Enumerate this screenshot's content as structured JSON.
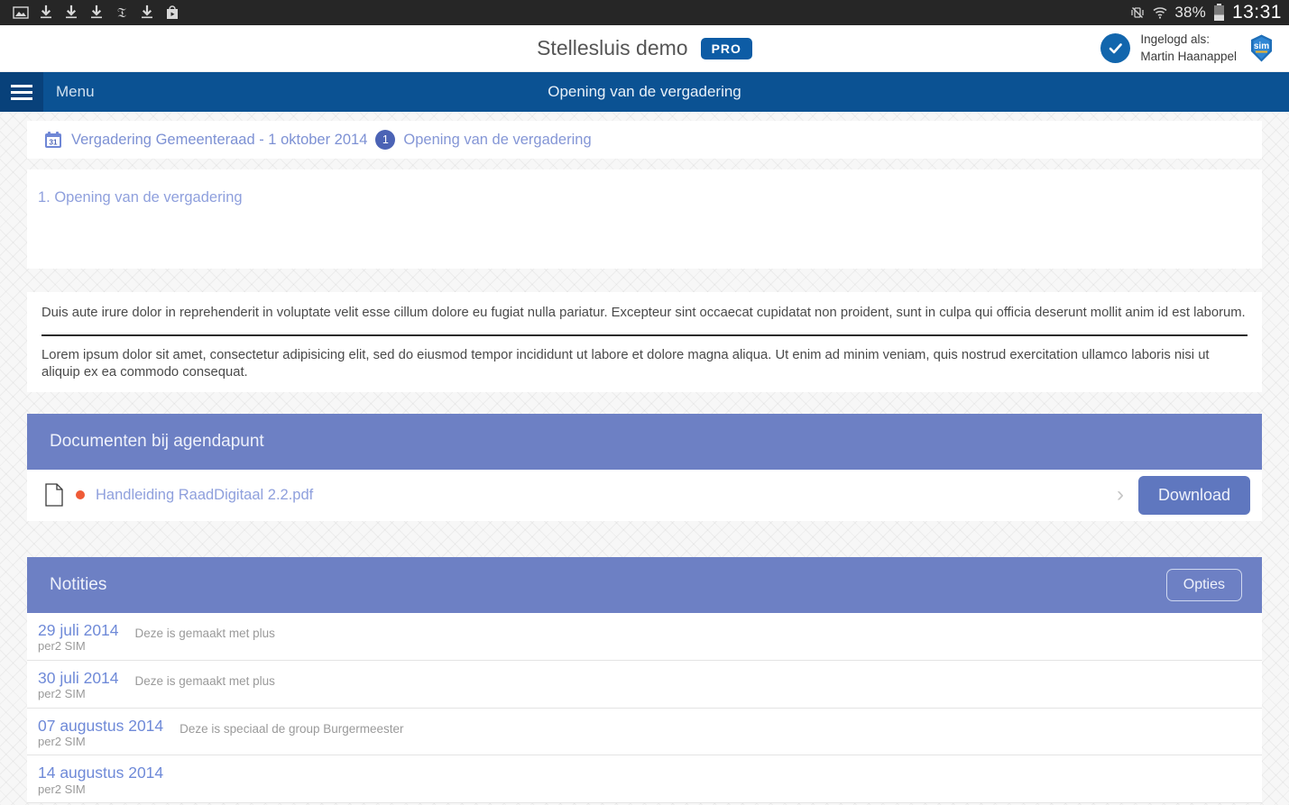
{
  "statusbar": {
    "icons": [
      "image-icon",
      "download-icon",
      "download-icon",
      "download-icon",
      "nyt-icon",
      "download-icon",
      "playstore-icon"
    ],
    "battery": "38%",
    "time": "13:31",
    "signal_icon": "wifi-icon",
    "vibrate_icon": "vibrate-off-icon"
  },
  "header": {
    "app_title": "Stellesluis demo",
    "pro_badge": "PRO",
    "account_label": "Ingelogd als:",
    "account_name": "Martin  Haanappel",
    "sim_logo_text": "sim"
  },
  "navbar": {
    "menu_label": "Menu",
    "page_title": "Opening van de vergadering"
  },
  "breadcrumb": {
    "calendar_day": "31",
    "meeting": "Vergadering Gemeenteraad - 1 oktober 2014",
    "item_number": "1",
    "item_title": "Opening van de vergadering"
  },
  "agenda": {
    "title": "1. Opening van de vergadering"
  },
  "body": {
    "paragraph1": "Duis aute irure dolor in reprehenderit in voluptate velit esse cillum dolore eu fugiat nulla pariatur. Excepteur sint occaecat cupidatat non proident, sunt in culpa qui officia deserunt mollit anim id est laborum.",
    "paragraph2": "Lorem ipsum dolor sit amet, consectetur adipisicing elit, sed do eiusmod tempor incididunt ut labore et dolore magna aliqua. Ut enim ad minim veniam, quis nostrud exercitation ullamco laboris nisi ut aliquip ex ea commodo consequat."
  },
  "documents": {
    "section_title": "Documenten bij agendapunt",
    "items": [
      {
        "name": "Handleiding RaadDigitaal 2.2.pdf",
        "download_label": "Download"
      }
    ]
  },
  "notes": {
    "section_title": "Notities",
    "options_label": "Opties",
    "rows": [
      {
        "date": "29 juli 2014",
        "author": "per2 SIM",
        "text": "Deze is gemaakt met plus"
      },
      {
        "date": "30 juli 2014",
        "author": "per2 SIM",
        "text": "Deze is gemaakt met plus"
      },
      {
        "date": "07 augustus 2014",
        "author": "per2 SIM",
        "text": "Deze is speciaal de group Burgermeester"
      },
      {
        "date": "14 augustus 2014",
        "author": "per2 SIM",
        "text": ""
      }
    ]
  },
  "colors": {
    "nav_blue": "#0b5293",
    "section_blue": "#6d80c4",
    "link_blue": "#8fa0dd",
    "accent_orange": "#ef5b37",
    "pro_blue": "#0d5ca5"
  }
}
